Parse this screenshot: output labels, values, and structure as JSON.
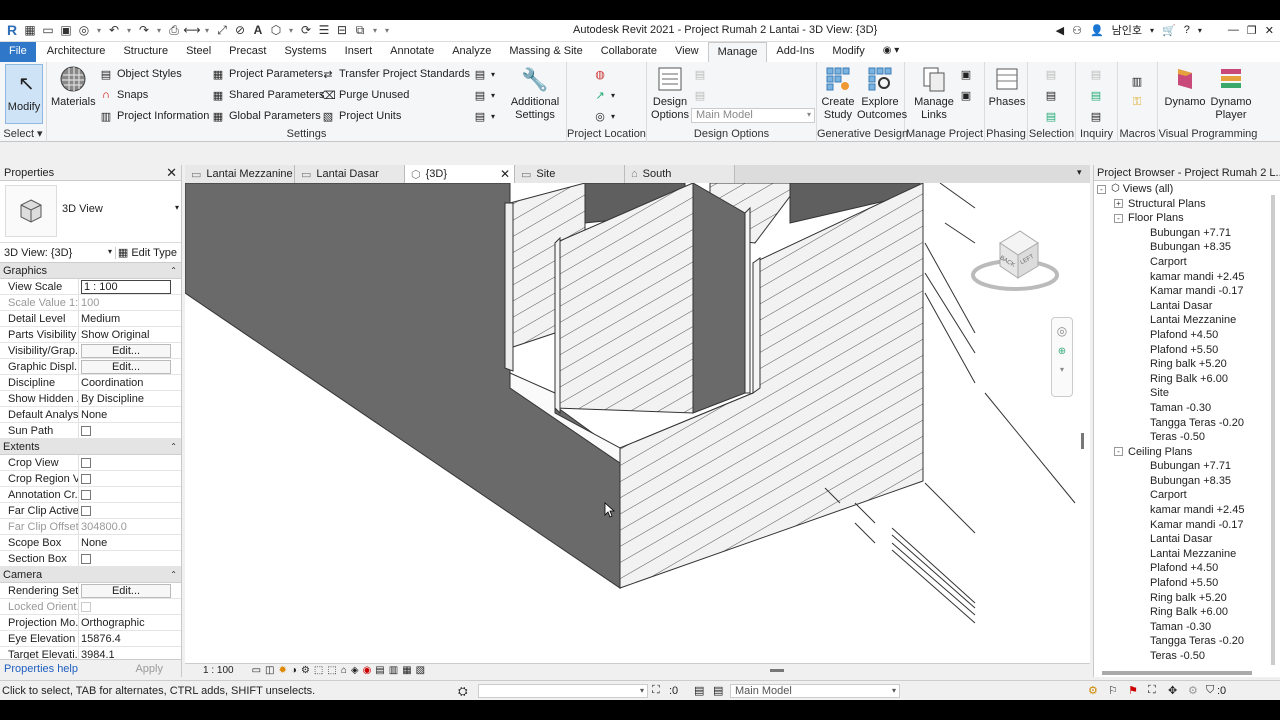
{
  "window": {
    "title": "Autodesk Revit 2021 - Project Rumah 2 Lantai - 3D View: {3D}"
  },
  "header_right": {
    "sign_in": "남인호"
  },
  "tabs": [
    "File",
    "Architecture",
    "Structure",
    "Steel",
    "Precast",
    "Systems",
    "Insert",
    "Annotate",
    "Analyze",
    "Massing & Site",
    "Collaborate",
    "View",
    "Manage",
    "Add-Ins",
    "Modify"
  ],
  "active_tab": "Manage",
  "ribbon": {
    "select": {
      "modify": "Modify",
      "panel": "Select"
    },
    "settings": {
      "materials": "Materials",
      "object_styles": "Object  Styles",
      "snaps": "Snaps",
      "project_information": "Project  Information",
      "project_parameters": "Project  Parameters",
      "shared_parameters": "Shared  Parameters",
      "global_parameters": "Global  Parameters",
      "transfer_project_standards": "Transfer  Project Standards",
      "purge_unused": "Purge  Unused",
      "project_units": "Project  Units",
      "additional_settings": "Additional Settings",
      "panel": "Settings"
    },
    "project_location": {
      "panel": "Project Location"
    },
    "design_options": {
      "design_options": "Design Options",
      "main_model": "Main Model",
      "panel": "Design Options"
    },
    "generative_design": {
      "create_study": "Create Study",
      "explore_outcomes": "Explore Outcomes",
      "panel": "Generative Design"
    },
    "manage_project": {
      "manage_links": "Manage Links",
      "panel": "Manage Project"
    },
    "phasing": {
      "phases": "Phases",
      "panel": "Phasing"
    },
    "selection": {
      "panel": "Selection"
    },
    "inquiry": {
      "panel": "Inquiry"
    },
    "macros": {
      "panel": "Macros"
    },
    "visual_programming": {
      "dynamo": "Dynamo",
      "dynamo_player": "Dynamo Player",
      "panel": "Visual Programming"
    }
  },
  "properties": {
    "title": "Properties",
    "type_name": "3D View",
    "filter": "3D View: {3D}",
    "edit_type": "Edit Type",
    "sections": [
      {
        "name": "Graphics",
        "rows": [
          {
            "k": "View Scale",
            "v": "1 : 100",
            "kind": "input"
          },
          {
            "k": "Scale Value    1:",
            "v": "100",
            "kind": "dim"
          },
          {
            "k": "Detail Level",
            "v": "Medium"
          },
          {
            "k": "Parts Visibility",
            "v": "Show Original"
          },
          {
            "k": "Visibility/Grap...",
            "v": "Edit...",
            "kind": "edit"
          },
          {
            "k": "Graphic Displ...",
            "v": "Edit...",
            "kind": "edit"
          },
          {
            "k": "Discipline",
            "v": "Coordination"
          },
          {
            "k": "Show Hidden ...",
            "v": "By Discipline"
          },
          {
            "k": "Default Analys...",
            "v": "None"
          },
          {
            "k": "Sun Path",
            "v": "",
            "kind": "check"
          }
        ]
      },
      {
        "name": "Extents",
        "rows": [
          {
            "k": "Crop View",
            "v": "",
            "kind": "check"
          },
          {
            "k": "Crop Region V...",
            "v": "",
            "kind": "check"
          },
          {
            "k": "Annotation Cr...",
            "v": "",
            "kind": "check"
          },
          {
            "k": "Far Clip Active",
            "v": "",
            "kind": "check"
          },
          {
            "k": "Far Clip Offset",
            "v": "304800.0",
            "kind": "dim"
          },
          {
            "k": "Scope Box",
            "v": "None"
          },
          {
            "k": "Section Box",
            "v": "",
            "kind": "check"
          }
        ]
      },
      {
        "name": "Camera",
        "rows": [
          {
            "k": "Rendering Set...",
            "v": "Edit...",
            "kind": "edit"
          },
          {
            "k": "Locked Orient...",
            "v": "",
            "kind": "dimcheck"
          },
          {
            "k": "Projection Mo...",
            "v": "Orthographic"
          },
          {
            "k": "Eye Elevation",
            "v": "15876.4"
          },
          {
            "k": "Target Elevati...",
            "v": "3984.1"
          }
        ]
      }
    ],
    "help": "Properties help",
    "apply": "Apply"
  },
  "view_tabs": [
    {
      "label": "Lantai Mezzanine",
      "icon": "plan-view-icon"
    },
    {
      "label": "Lantai Dasar",
      "icon": "plan-view-icon"
    },
    {
      "label": "{3D}",
      "icon": "3d-view-icon",
      "active": true
    },
    {
      "label": "Site",
      "icon": "plan-view-icon"
    },
    {
      "label": "South",
      "icon": "elevation-view-icon"
    }
  ],
  "viewcube": {
    "back": "BACK",
    "left": "LEFT"
  },
  "view_bar": {
    "scale": "1 : 100"
  },
  "browser": {
    "title": "Project Browser - Project Rumah 2 L...",
    "views_all": "Views (all)",
    "structural_plans": "Structural Plans",
    "floor_plans": "Floor Plans",
    "floor_items": [
      "Bubungan +7.71",
      "Bubungan +8.35",
      "Carport",
      "kamar mandi +2.45",
      "Kamar mandi -0.17",
      "Lantai Dasar",
      "Lantai Mezzanine",
      "Plafond +4.50",
      "Plafond +5.50",
      "Ring balk +5.20",
      "Ring Balk +6.00",
      "Site",
      "Taman -0.30",
      "Tangga Teras -0.20",
      "Teras -0.50"
    ],
    "ceiling_plans": "Ceiling Plans",
    "ceiling_items": [
      "Bubungan +7.71",
      "Bubungan +8.35",
      "Carport",
      "kamar mandi +2.45",
      "Kamar mandi -0.17",
      "Lantai Dasar",
      "Lantai Mezzanine",
      "Plafond +4.50",
      "Plafond +5.50",
      "Ring balk +5.20",
      "Ring Balk +6.00",
      "Taman -0.30",
      "Tangga Teras -0.20",
      "Teras -0.50"
    ]
  },
  "status": {
    "text": "Click to select, TAB for alternates, CTRL adds, SHIFT unselects.",
    "zero1": ":0",
    "main_model": "Main Model",
    "filter_count": ":0"
  }
}
